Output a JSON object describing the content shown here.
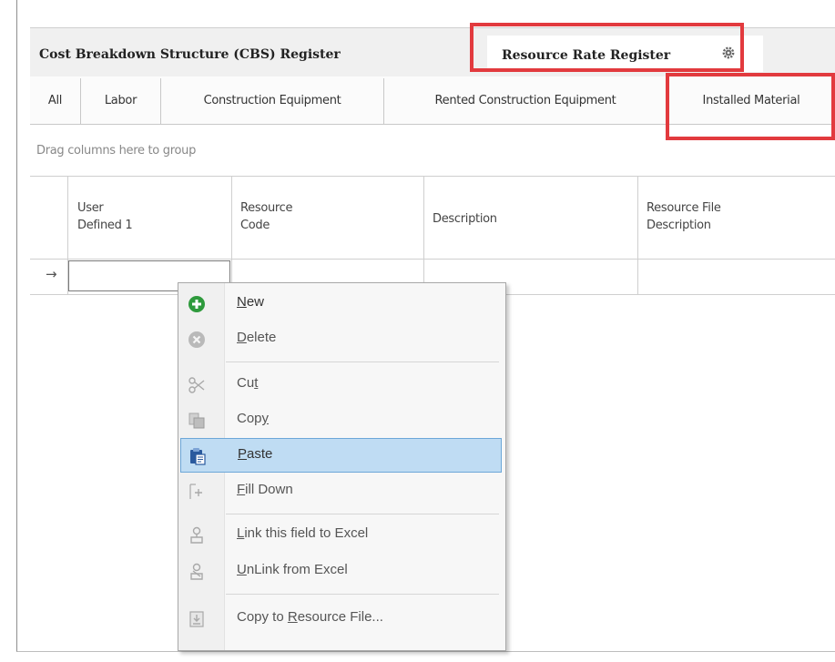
{
  "doc_tabs": {
    "cbs_label": "Cost Breakdown Structure (CBS) Register",
    "rrr_label": "Resource Rate Register",
    "settings_icon": "gear-icon"
  },
  "sub_tabs": [
    {
      "label": "All"
    },
    {
      "label": "Labor"
    },
    {
      "label": "Construction Equipment"
    },
    {
      "label": "Rented Construction Equipment"
    },
    {
      "label": "Installed Material"
    }
  ],
  "group_hint": "Drag columns here to group",
  "columns": {
    "user_defined_line1": "User",
    "user_defined_line2": "Defined 1",
    "resource_code_line1": "Resource",
    "resource_code_line2": "Code",
    "description": "Description",
    "resource_file_line1": "Resource File",
    "resource_file_line2": "Description"
  },
  "row_indicator": "→",
  "context_menu": {
    "items": [
      {
        "prefix": "",
        "key": "N",
        "rest": "ew",
        "icon": "plus-circle-icon",
        "enabled": true
      },
      {
        "prefix": "",
        "key": "D",
        "rest": "elete",
        "icon": "x-circle-icon",
        "enabled": false
      },
      {
        "prefix": "Cu",
        "key": "t",
        "rest": "",
        "icon": "scissors-icon",
        "enabled": false
      },
      {
        "prefix": "Cop",
        "key": "y",
        "rest": "",
        "icon": "copy-icon",
        "enabled": false
      },
      {
        "prefix": "",
        "key": "P",
        "rest": "aste",
        "icon": "clipboard-icon",
        "enabled": true,
        "selected": true
      },
      {
        "prefix": "",
        "key": "F",
        "rest": "ill Down",
        "icon": "fill-down-icon",
        "enabled": false
      },
      {
        "prefix": "",
        "key": "L",
        "rest": "ink this field to Excel",
        "icon": "link-excel-icon",
        "enabled": false
      },
      {
        "prefix": "",
        "key": "U",
        "rest": "nLink from Excel",
        "icon": "unlink-excel-icon",
        "enabled": false
      },
      {
        "prefix": "Copy to ",
        "key": "R",
        "rest": "esource File...",
        "icon": "copy-to-file-icon",
        "enabled": false
      }
    ]
  },
  "colors": {
    "highlight": "#e23a3e",
    "selection": "#bfdcf3",
    "new_icon": "#2e9a3c"
  }
}
